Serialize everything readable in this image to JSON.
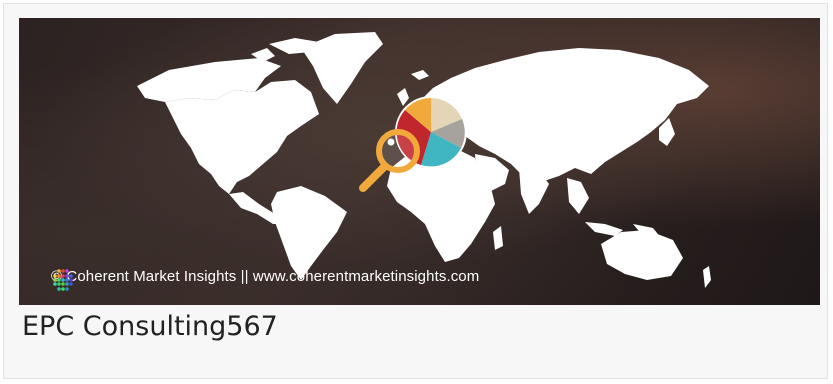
{
  "card": {
    "banner": {
      "watermark_text": "© Coherent Market Insights || www.coherentmarketinsights.com",
      "logo_icon": "dot-grid-logo-icon",
      "map_icon": "world-map-icon",
      "pie_icon": "pie-chart-icon",
      "magnifier_icon": "magnifying-glass-icon",
      "pie_colors": [
        "#e4d5b7",
        "#a6a29d",
        "#3fb6c1",
        "#c0272d",
        "#f2a93b"
      ]
    },
    "title": "EPC Consulting567"
  }
}
